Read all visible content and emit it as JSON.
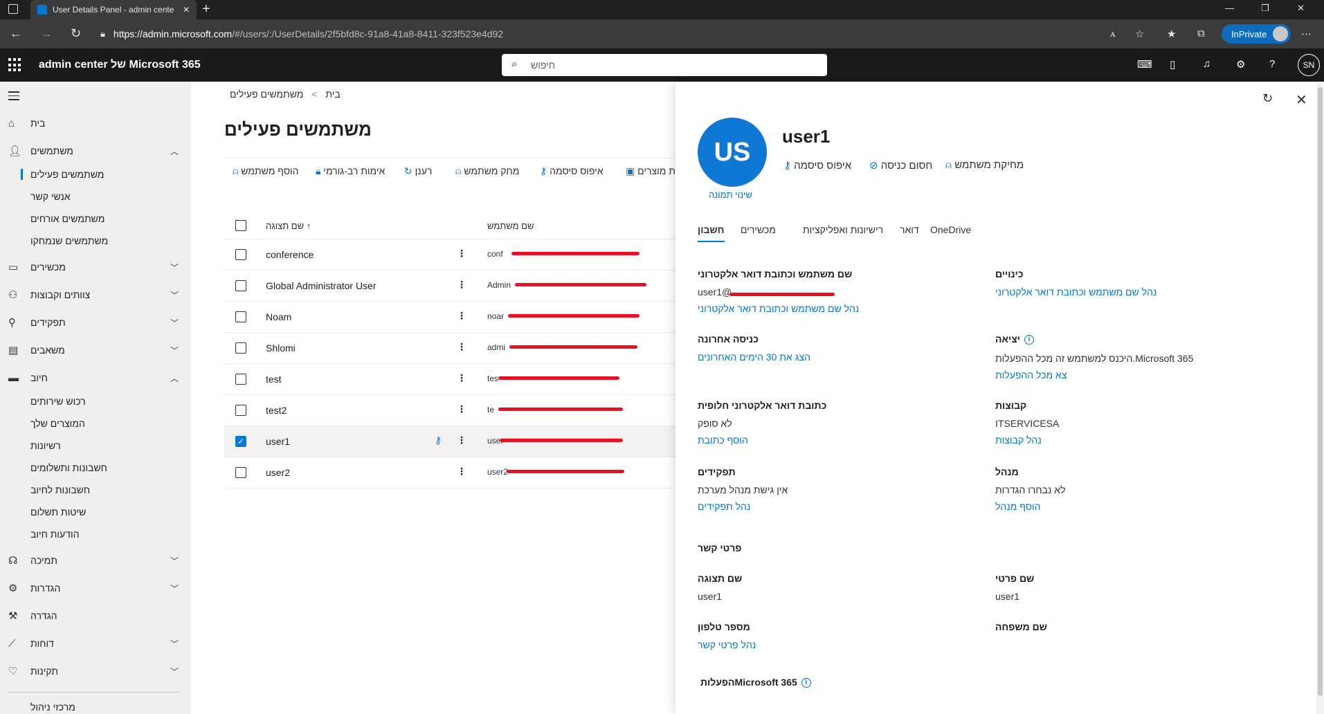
{
  "browser": {
    "tab_title": "User Details Panel - admin cente",
    "url_host": "https://admin.microsoft.com",
    "url_path": "/#/users/:/UserDetails/2f5bfd8c-91a8-41a8-8411-323f523e4d92",
    "inprivate_label": "InPrivate"
  },
  "header": {
    "app_name": "admin center של Microsoft 365",
    "search_placeholder": "חיפוש",
    "avatar_initials": "SN"
  },
  "nav": {
    "items": [
      {
        "label": "בית",
        "icon": "home-icon"
      },
      {
        "label": "משתמשים",
        "icon": "person-icon",
        "expanded": true
      },
      {
        "label": "מכשירים",
        "icon": "devices-icon"
      },
      {
        "label": "צוותים וקבוצות",
        "icon": "teams-icon"
      },
      {
        "label": "תפקידים",
        "icon": "roles-icon"
      },
      {
        "label": "משאבים",
        "icon": "resources-icon"
      },
      {
        "label": "חיוב",
        "icon": "billing-icon",
        "expanded": true
      },
      {
        "label": "תמיכה",
        "icon": "support-icon"
      },
      {
        "label": "הגדרות",
        "icon": "gear-icon"
      },
      {
        "label": "הגדרה",
        "icon": "wrench-icon"
      },
      {
        "label": "דוחות",
        "icon": "chart-icon"
      },
      {
        "label": "תקינות",
        "icon": "health-icon"
      }
    ],
    "users_sub": [
      "משתמשים פעילים",
      "אנשי קשר",
      "משתמשים אורחים",
      "משתמשים שנמחקו"
    ],
    "billing_sub": [
      "רכוש שירותים",
      "המוצרים שלך",
      "רשיונות",
      "חשבונות ותשלומים",
      "חשבונות לחיוב",
      "שיטות תשלום",
      "הודעות חיוב"
    ],
    "footer": "מרכזי ניהול"
  },
  "main": {
    "breadcrumb_home": "בית",
    "breadcrumb_sep": ">",
    "breadcrumb_current": "משתמשים פעילים",
    "title": "משתמשים פעילים",
    "commands": [
      "הוסף משתמש",
      "אימות רב-גורמי",
      "רענן",
      "מחק משתמש",
      "איפוס סיסמה",
      "ת מוצרים"
    ],
    "col_display_name": "שם תצוגה",
    "col_username": "שם משתמש",
    "sort_arrow": "↑",
    "rows": [
      {
        "name": "conference",
        "upn": "conf",
        "selected": false
      },
      {
        "name": "Global Administrator User",
        "upn": "Admin",
        "selected": false
      },
      {
        "name": "Noam",
        "upn": "noar",
        "selected": false
      },
      {
        "name": "Shlomi",
        "upn": "admi",
        "selected": false
      },
      {
        "name": "test",
        "upn": "tes",
        "selected": false
      },
      {
        "name": "test2",
        "upn": "te",
        "selected": false
      },
      {
        "name": "user1",
        "upn": "user",
        "selected": true
      },
      {
        "name": "user2",
        "upn": "user2",
        "selected": false
      }
    ]
  },
  "panel": {
    "avatar_initials": "US",
    "change_photo": "שינוי תמונה",
    "user_name": "user1",
    "actions": [
      "איפוס סיסמה",
      "חסום כניסה",
      "מחיקת משתמש"
    ],
    "tabs": [
      "חשבון",
      "מכשירים",
      "רישיונות ואפליקציות",
      "דואר",
      "OneDrive"
    ],
    "active_tab": "חשבון",
    "sections": {
      "upn_title": "שם משתמש וכתובת דואר אלקטרוני",
      "upn_value": "user1@",
      "upn_link": "נהל שם משתמש וכתובת דואר אלקטרוני",
      "aliases_title": "כינויים",
      "aliases_link": "נהל שם משתמש וכתובת דואר אלקטרוני",
      "last_signin_title": "כניסה אחרונה",
      "last_signin_link": "הצג את 30 הימים האחרונים",
      "signout_title": "יציאה",
      "signout_value": "היכנס למשתמש זה מכל ההפעלות.Microsoft 365",
      "signout_link": "צא מכל ההפעלות",
      "alt_email_title": "כתובת דואר אלקטרוני חלופית",
      "alt_email_value": "לא סופק",
      "alt_email_link": "הוסף כתובת",
      "groups_title": "קבוצות",
      "groups_value": "ITSERVICESA",
      "groups_link": "נהל קבוצות",
      "roles_title": "תפקידים",
      "roles_value": "אין גישת מנהל מערכת",
      "roles_link": "נהל תפקידים",
      "manager_title": "מנהל",
      "manager_value": "לא נבחרו הגדרות",
      "manager_link": "הוסף מנהל",
      "contact_title": "פרטי קשר",
      "display_name_title": "שם תצוגה",
      "display_name_value": "user1",
      "first_name_title": "שם פרטי",
      "first_name_value": "user1",
      "phone_title": "מספר טלפון",
      "phone_link": "נהל פרטי קשר",
      "last_name_title": "שם משפחה",
      "activations_title": "הפעלותMicrosoft 365"
    }
  },
  "colors": {
    "accent": "#0078d4",
    "redaction": "#e81123",
    "header_bg": "#1b1a19"
  }
}
